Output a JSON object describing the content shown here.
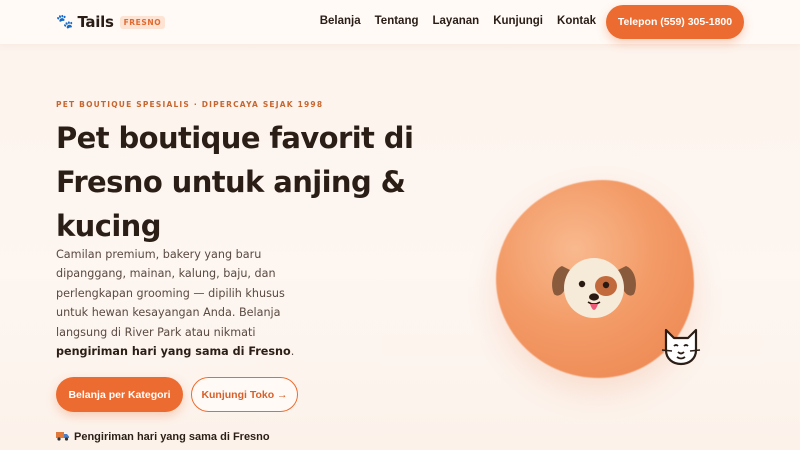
{
  "brand": {
    "name": "Tails",
    "badge": "FRESNO"
  },
  "nav": {
    "items": [
      "Belanja",
      "Tentang",
      "Layanan",
      "Kunjungi",
      "Kontak"
    ],
    "phone_cta": "Telepon (559) 305-1800"
  },
  "hero": {
    "eyebrow": "PET BOUTIQUE SPESIALIS · DIPERCAYA SEJAK 1998",
    "title": "Pet boutique favorit di Fresno untuk anjing & kucing",
    "description": "Camilan premium, bakery yang baru dipanggang, mainan, kalung, baju, dan perlengkapan grooming — dipilih khusus untuk hewan kesayangan Anda. Belanja langsung di River Park atau nikmati",
    "description_bold": "pengiriman hari yang sama di Fresno",
    "description_end": ".",
    "primary_button": "Belanja per Kategori",
    "secondary_button": "Kunjungi Toko →",
    "delivery_note": "Pengiriman hari yang sama di Fresno"
  },
  "icons": {
    "logo": "paw-icon",
    "delivery": "truck-icon",
    "hero_pet": "dog-face-icon",
    "hero_pet_2": "cat-face-icon"
  },
  "colors": {
    "accent": "#ec6b30",
    "heading": "#2b1e17",
    "background": "#fdf3ec"
  }
}
